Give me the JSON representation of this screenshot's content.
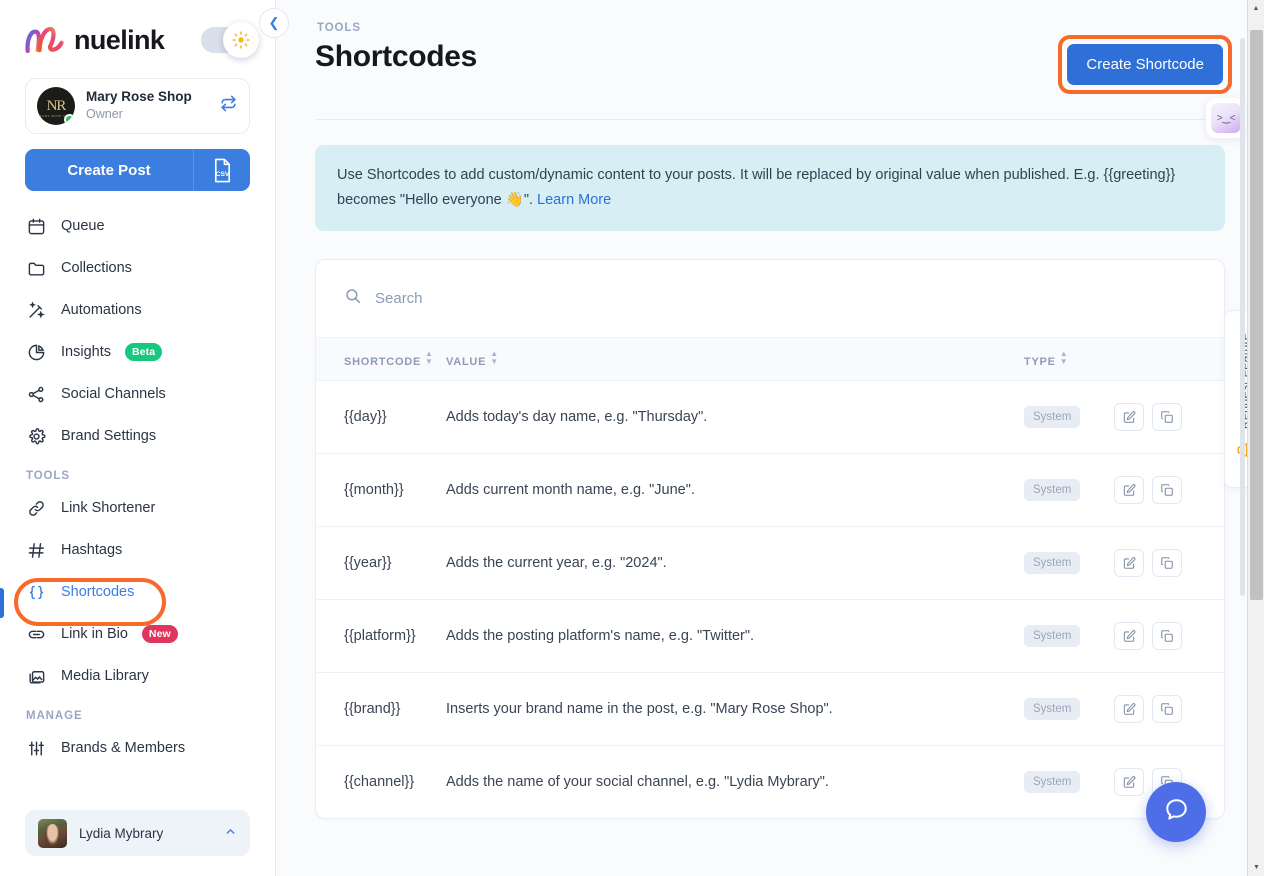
{
  "app": {
    "logo_text": "nuelink",
    "theme_icon": "sun-icon",
    "collapse_icon": "chevron-left-icon"
  },
  "sidebar": {
    "brand": {
      "name": "Mary Rose Shop",
      "role": "Owner",
      "avatar_initials": "NR",
      "avatar_subtext": "MARY ROSE SHOP",
      "switch_icon": "swap-icon"
    },
    "create_post_label": "Create Post",
    "csv_icon": "csv-file-icon",
    "items": [
      {
        "label": "Queue",
        "icon": "calendar-icon",
        "badge": null,
        "active": false
      },
      {
        "label": "Collections",
        "icon": "folder-icon",
        "badge": null,
        "active": false
      },
      {
        "label": "Automations",
        "icon": "magic-wand-icon",
        "badge": null,
        "active": false
      },
      {
        "label": "Insights",
        "icon": "pie-chart-icon",
        "badge": "Beta",
        "badge_kind": "beta",
        "active": false
      },
      {
        "label": "Social Channels",
        "icon": "share-icon",
        "badge": null,
        "active": false
      },
      {
        "label": "Brand Settings",
        "icon": "gear-icon",
        "badge": null,
        "active": false
      }
    ],
    "section_tools_label": "TOOLS",
    "tools_items": [
      {
        "label": "Link Shortener",
        "icon": "link-icon",
        "badge": null,
        "active": false
      },
      {
        "label": "Hashtags",
        "icon": "hash-icon",
        "badge": null,
        "active": false
      },
      {
        "label": "Shortcodes",
        "icon": "curly-braces-icon",
        "badge": null,
        "active": true
      },
      {
        "label": "Link in Bio",
        "icon": "chain-link-icon",
        "badge": "New",
        "badge_kind": "new",
        "active": false
      },
      {
        "label": "Media Library",
        "icon": "image-library-icon",
        "badge": null,
        "active": false
      }
    ],
    "section_manage_label": "MANAGE",
    "manage_items": [
      {
        "label": "Brands & Members",
        "icon": "sliders-icon",
        "badge": null,
        "active": false
      }
    ],
    "user": {
      "name": "Lydia Mybrary",
      "caret_icon": "chevron-up-icon"
    }
  },
  "header": {
    "breadcrumb": "TOOLS",
    "title": "Shortcodes",
    "create_button_label": "Create Shortcode"
  },
  "banner": {
    "text_part1": "Use Shortcodes to add custom/dynamic content to your posts. It will be replaced by original value when published. E.g. {{greeting}} becomes \"Hello everyone ",
    "emoji": "👋",
    "text_part2": "\". ",
    "link_label": "Learn More"
  },
  "search": {
    "placeholder": "Search",
    "value": "",
    "icon": "search-icon"
  },
  "table": {
    "columns": [
      {
        "key": "shortcode",
        "label": "SHORTCODE",
        "sortable": true
      },
      {
        "key": "value",
        "label": "VALUE",
        "sortable": true
      },
      {
        "key": "type",
        "label": "TYPE",
        "sortable": true
      }
    ],
    "rows": [
      {
        "shortcode": "{{day}}",
        "value": "Adds today's day name, e.g. \"Thursday\".",
        "type": "System",
        "edit_icon": "edit-icon",
        "copy_icon": "copy-icon"
      },
      {
        "shortcode": "{{month}}",
        "value": "Adds current month name, e.g. \"June\".",
        "type": "System",
        "edit_icon": "edit-icon",
        "copy_icon": "copy-icon"
      },
      {
        "shortcode": "{{year}}",
        "value": "Adds the current year, e.g. \"2024\".",
        "type": "System",
        "edit_icon": "edit-icon",
        "copy_icon": "copy-icon"
      },
      {
        "shortcode": "{{platform}}",
        "value": "Adds the posting platform's name, e.g. \"Twitter\".",
        "type": "System",
        "edit_icon": "edit-icon",
        "copy_icon": "copy-icon"
      },
      {
        "shortcode": "{{brand}}",
        "value": "Inserts your brand name in the post, e.g. \"Mary Rose Shop\".",
        "type": "System",
        "edit_icon": "edit-icon",
        "copy_icon": "copy-icon"
      },
      {
        "shortcode": "{{channel}}",
        "value": "Adds the name of your social channel, e.g. \"Lydia Mybrary\".",
        "type": "System",
        "edit_icon": "edit-icon",
        "copy_icon": "copy-icon"
      }
    ]
  },
  "right_rail": {
    "kawaii_face": ">‿<",
    "request_feature_label": "Request Feature",
    "request_feature_icon": "megaphone-icon",
    "help_icon": "chat-bubble-icon"
  },
  "annotations": {
    "highlight_color": "#f86a29",
    "targets": [
      "create-shortcode-button",
      "sidebar-item-shortcodes"
    ]
  },
  "colors": {
    "accent_blue": "#2f6fd8",
    "sidebar_active": "#3b7ee0",
    "banner_bg": "#d6eef4",
    "badge_beta": "#16c97e",
    "badge_new": "#e0365e",
    "page_bg": "#fafbfd"
  }
}
